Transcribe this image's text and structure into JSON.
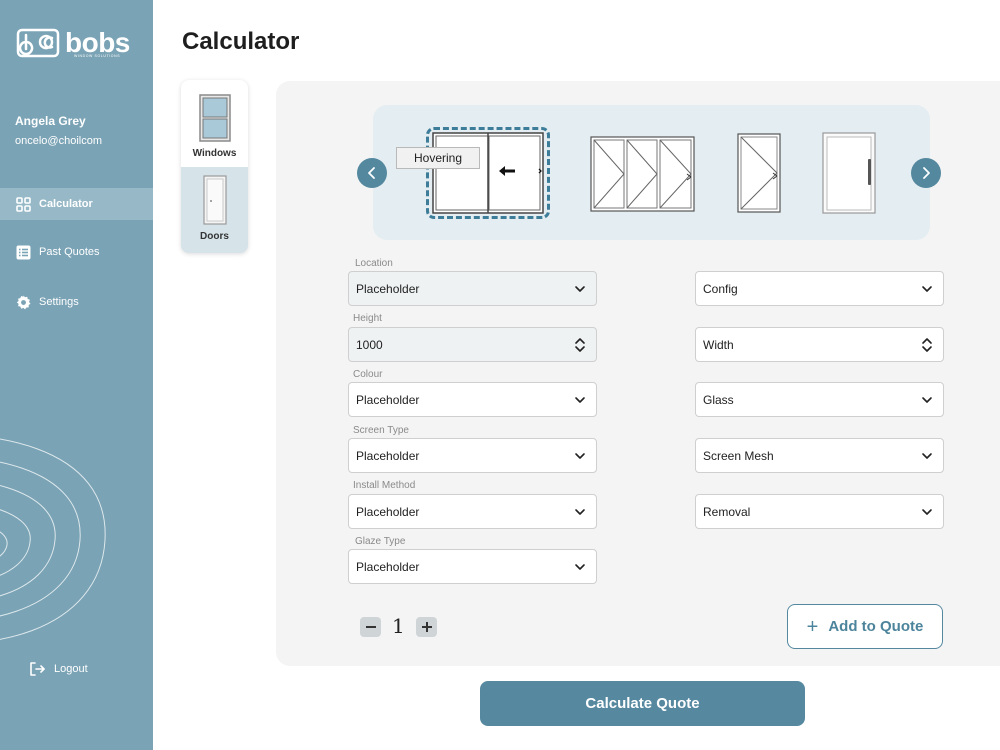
{
  "brand": {
    "name": "bobs",
    "tagline": "WINDOW SOLUTIONS"
  },
  "user": {
    "name": "Angela Grey",
    "email": "oncelo@choilcom"
  },
  "nav": {
    "items": [
      {
        "label": "Calculator",
        "icon": "grid-icon",
        "active": true
      },
      {
        "label": "Past Quotes",
        "icon": "list-icon",
        "active": false
      },
      {
        "label": "Settings",
        "icon": "gear-icon",
        "active": false
      }
    ],
    "logout": "Logout"
  },
  "page": {
    "title": "Calculator"
  },
  "product_types": [
    {
      "label": "Windows",
      "selected": true
    },
    {
      "label": "Doors",
      "selected": false
    }
  ],
  "carousel": {
    "tooltip": "Hovering",
    "options": [
      "sliding-door-icon",
      "bifold-door-icon",
      "hinged-door-icon",
      "single-door-icon"
    ]
  },
  "form": {
    "location": {
      "label": "Location",
      "value": "Placeholder"
    },
    "height": {
      "label": "Height",
      "value": "1000"
    },
    "colour": {
      "label": "Colour",
      "value": "Placeholder"
    },
    "screen_type": {
      "label": "Screen Type",
      "value": "Placeholder"
    },
    "install_method": {
      "label": "Install Method",
      "value": "Placeholder"
    },
    "glaze_type": {
      "label": "Glaze Type",
      "value": "Placeholder"
    },
    "config": {
      "value": "Config"
    },
    "width": {
      "value": "Width"
    },
    "glass": {
      "value": "Glass"
    },
    "screen_mesh": {
      "value": "Screen Mesh"
    },
    "removal": {
      "value": "Removal"
    }
  },
  "quantity": "1",
  "actions": {
    "add_to_quote": "Add to Quote",
    "calculate_quote": "Calculate Quote"
  },
  "colors": {
    "sidebar": "#7aa3b5",
    "accent": "#5689a0",
    "active_nav": "#97b9c7"
  }
}
